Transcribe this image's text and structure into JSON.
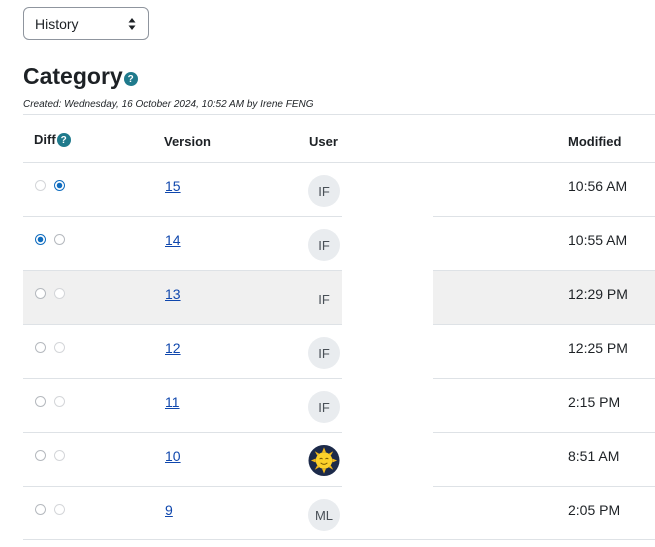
{
  "history_select": {
    "value": "History"
  },
  "page": {
    "title": "Category",
    "created": "Created: Wednesday, 16 October 2024, 10:52 AM by Irene FENG"
  },
  "table": {
    "headers": {
      "diff": "Diff",
      "version": "Version",
      "user": "User",
      "modified": "Modified"
    },
    "rows": [
      {
        "version": "15",
        "user_initials": "IF",
        "modified": "10:56 AM"
      },
      {
        "version": "14",
        "user_initials": "IF",
        "modified": "10:55 AM"
      },
      {
        "version": "13",
        "user_initials": "IF",
        "modified": "12:29 PM"
      },
      {
        "version": "12",
        "user_initials": "IF",
        "modified": "12:25 PM"
      },
      {
        "version": "11",
        "user_initials": "IF",
        "modified": "2:15 PM"
      },
      {
        "version": "10",
        "user_initials": "",
        "modified": "8:51 AM"
      },
      {
        "version": "9",
        "user_initials": "ML",
        "modified": "2:05 PM"
      }
    ]
  },
  "icons": {
    "help": "question-circle-icon",
    "caret": "sort-caret-icon",
    "avatar_picture": "sun-avatar-picture"
  },
  "colors": {
    "link": "#0f47ad",
    "radio_checked": "#0f6cbf",
    "help_icon": "#1f7a8c",
    "row_alt": "#f0f0f0"
  }
}
